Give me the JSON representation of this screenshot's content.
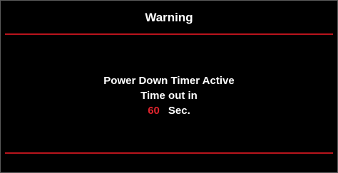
{
  "dialog": {
    "title": "Warning",
    "message_line1": "Power Down Timer Active",
    "message_line2": "Time out in",
    "countdown_value": "60",
    "countdown_unit": "Sec."
  },
  "colors": {
    "background": "#000000",
    "text": "#ffffff",
    "accent_rule": "#b8141c",
    "countdown": "#e0242d"
  }
}
